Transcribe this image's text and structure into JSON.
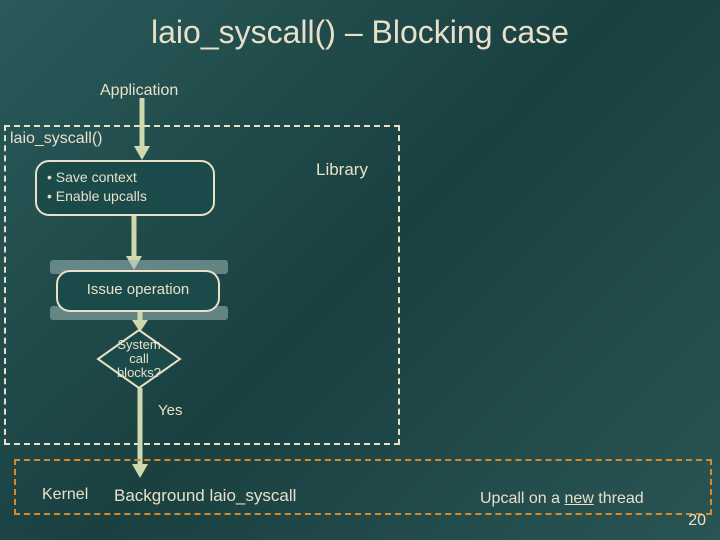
{
  "title": "laio_syscall() – Blocking case",
  "labels": {
    "application": "Application",
    "library": "Library",
    "syscall": "laio_syscall()",
    "issue": "Issue operation",
    "yes": "Yes",
    "kernel": "Kernel",
    "background": "Background laio_syscall",
    "upcall_prefix": "Upcall on a ",
    "upcall_new": "new",
    "upcall_suffix": " thread"
  },
  "save_box": {
    "line1": "• Save context",
    "line2": "• Enable upcalls"
  },
  "diamond": {
    "line1": "System",
    "line2": "call",
    "line3": "blocks?"
  },
  "slide_number": "20",
  "colors": {
    "accent_border": "#e8e0c8",
    "kernel_border": "#d88a2a",
    "arrow": "#d0d8b0"
  }
}
